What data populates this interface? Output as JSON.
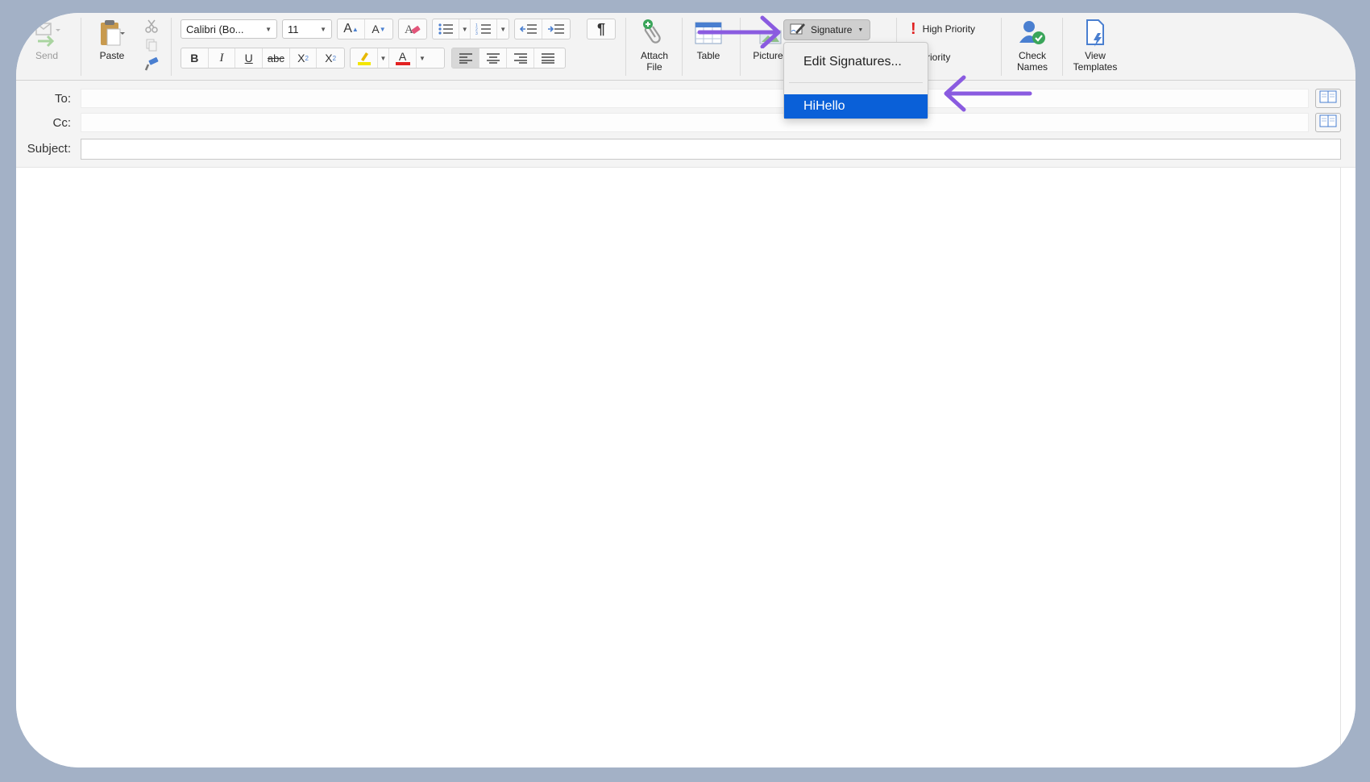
{
  "ribbon": {
    "send_label": "Send",
    "paste_label": "Paste",
    "font_name": "Calibri (Bo...",
    "font_size": "11",
    "attach_label_1": "Attach",
    "attach_label_2": "File",
    "table_label": "Table",
    "pictures_label": "Pictures",
    "signature_label": "Signature",
    "high_priority_label": "High Priority",
    "low_priority_label": "w Priority",
    "check_names_1": "Check",
    "check_names_2": "Names",
    "view_templates_1": "View",
    "view_templates_2": "Templates",
    "format": {
      "bold": "B",
      "italic": "I",
      "underline": "U",
      "strike": "abc",
      "sub": "X",
      "sup": "X",
      "sub_mark": "2",
      "sup_mark": "2",
      "grow": "A",
      "shrink": "A",
      "pilcrow": "¶",
      "font_color": "A"
    }
  },
  "fields": {
    "to_label": "To:",
    "cc_label": "Cc:",
    "subject_label": "Subject:"
  },
  "signature_menu": {
    "edit_label": "Edit Signatures...",
    "item_label": "HiHello"
  },
  "colors": {
    "accent_arrow": "#8a5be0",
    "menu_selected": "#0a60d8",
    "font_color_bar": "#e32222",
    "highlight_bar": "#f3e600",
    "priority_red": "#e02020"
  }
}
